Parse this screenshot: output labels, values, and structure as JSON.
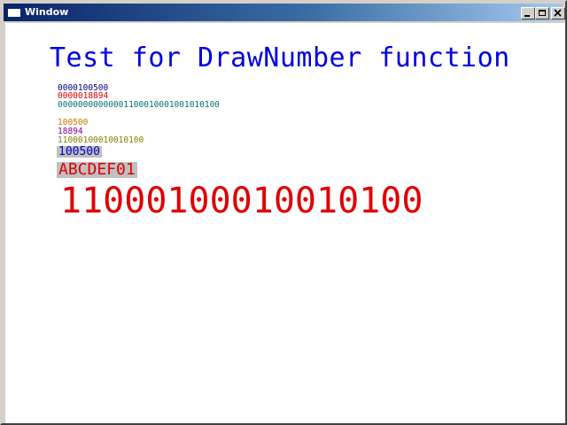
{
  "window": {
    "title": "Window",
    "icon": "window-app-icon",
    "controls": {
      "minimize": "minimize-icon",
      "maximize": "maximize-icon",
      "close": "close-icon"
    }
  },
  "content": {
    "heading": "Test for DrawNumber function",
    "lines": [
      {
        "text": "0000100500",
        "color": "#000080"
      },
      {
        "text": "0000018894",
        "color": "#e00000"
      },
      {
        "text": "00000000000001100010001001010100",
        "color": "#007070"
      },
      {
        "text": "100500",
        "color": "#d07000"
      },
      {
        "text": "18894",
        "color": "#800080"
      },
      {
        "text": "11000100010010100",
        "color": "#808000"
      },
      {
        "text": "100500",
        "color": "#0000c0",
        "background": "#c0c0c0"
      },
      {
        "text": "ABCDEF01",
        "color": "#e00000",
        "background": "#c0c0c0"
      }
    ],
    "big_number": {
      "text": "11000100010010100",
      "color": "#e00000"
    }
  },
  "colors": {
    "titlebar_start": "#0a246a",
    "titlebar_end": "#a6caf0",
    "heading": "#0000e0",
    "client_background": "#ffffff"
  }
}
